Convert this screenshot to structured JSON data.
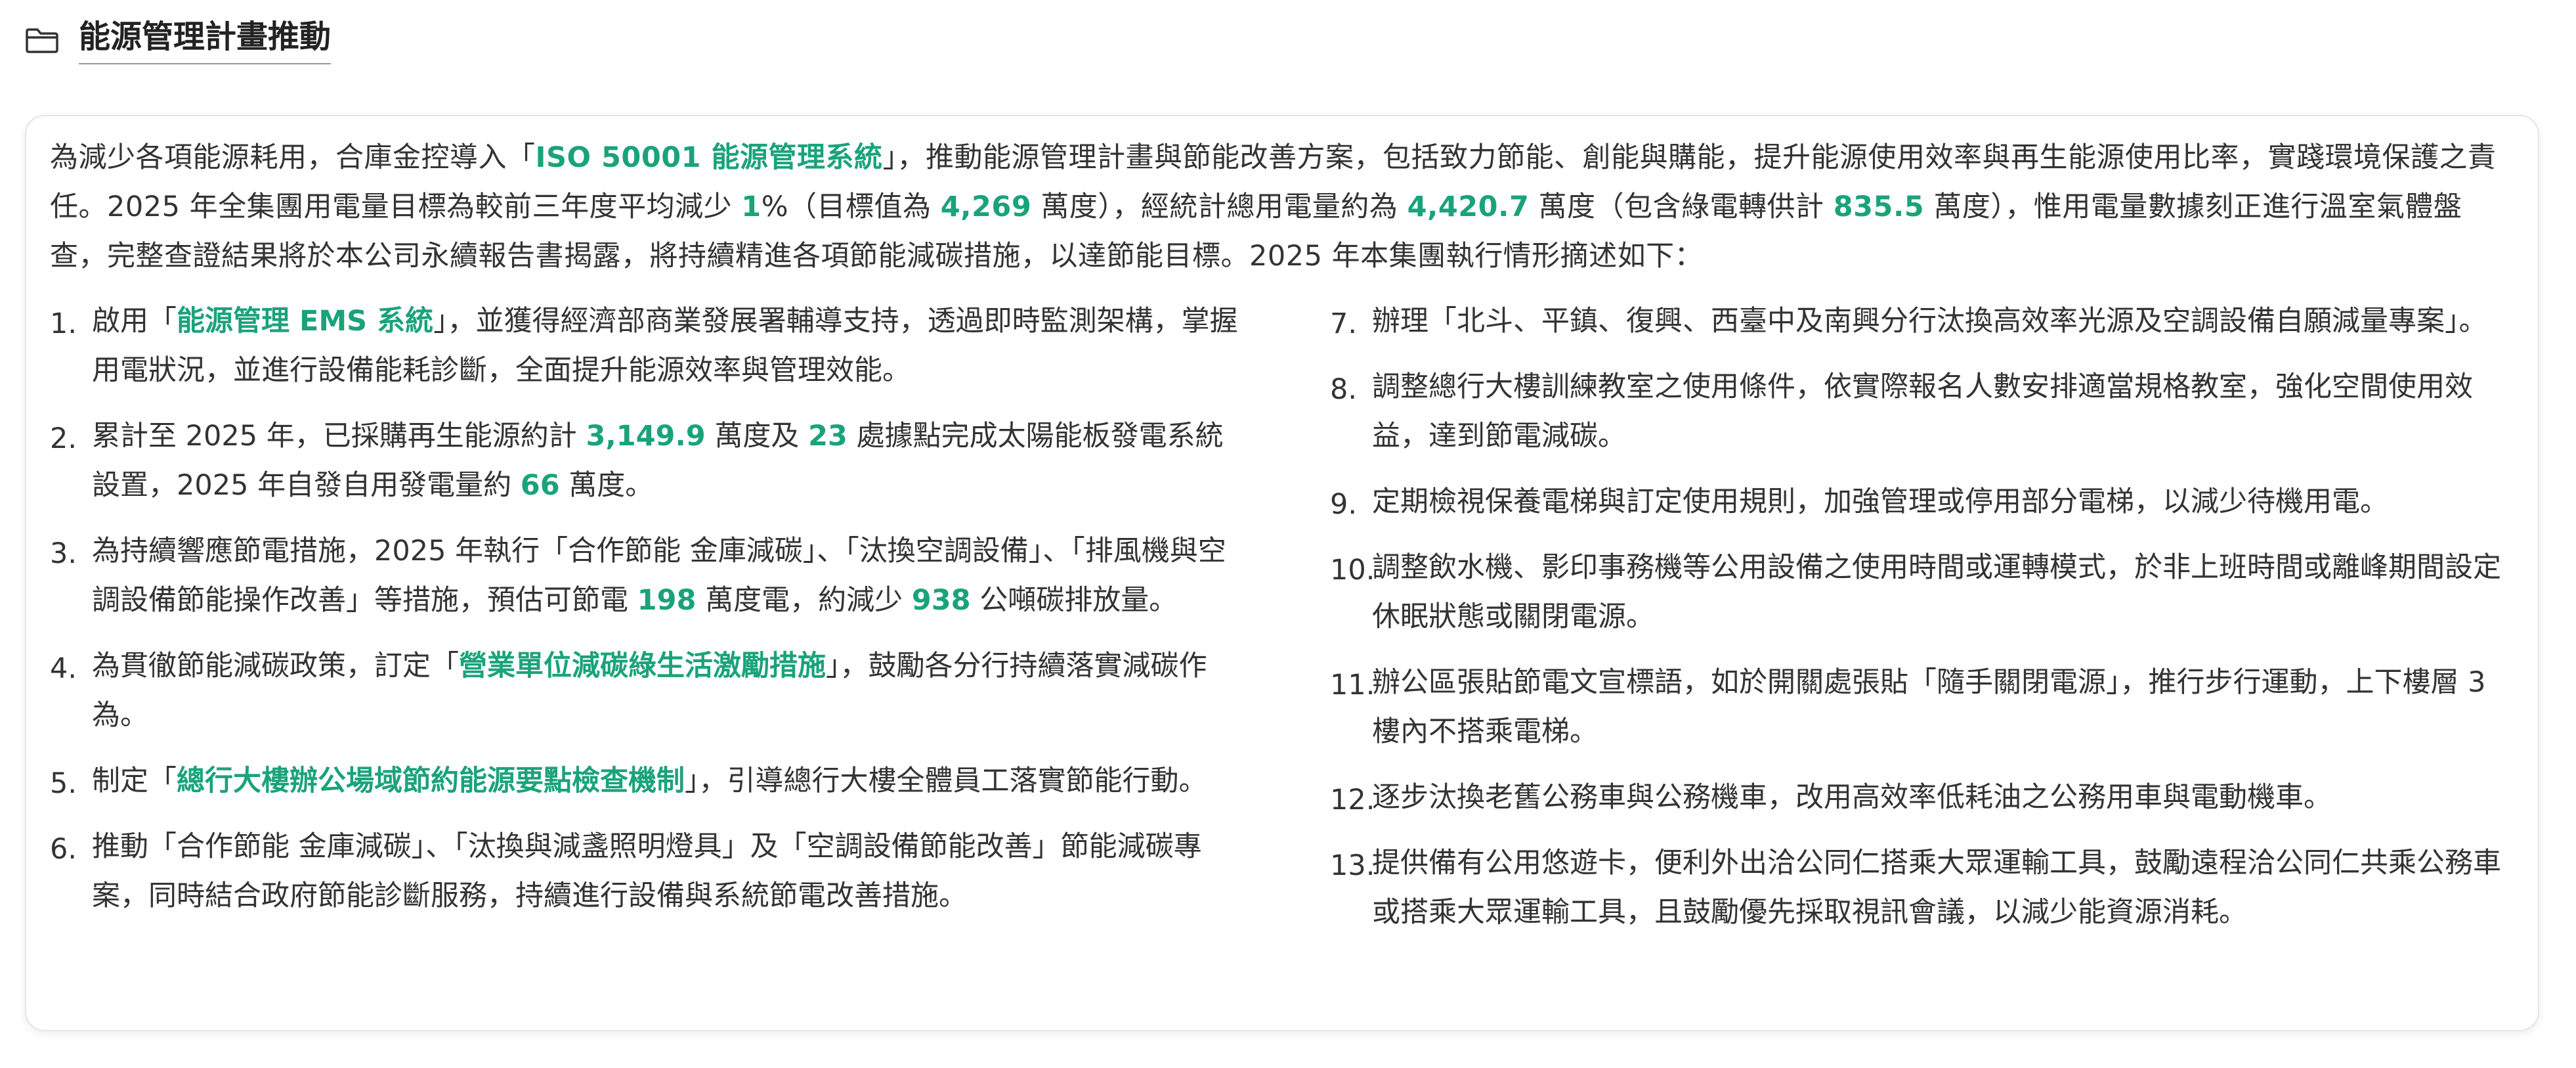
{
  "section": {
    "icon": "folder-icon",
    "title": "能源管理計畫推動"
  },
  "intro": {
    "t1": "為減少各項能源耗用，合庫金控導入「",
    "h1": "ISO 50001 能源管理系統",
    "t2": "」，推動能源管理計畫與節能改善方案，包括致力節能、創能與購能，提升能源使用效率與再生能源使用比率，實踐環境保護之責任。2025 年全集團用電量目標為較前三年度平均減少 ",
    "h2": "1",
    "t3": "%（目標值為 ",
    "h3": "4,269",
    "t4": " 萬度），經統計總用電量約為 ",
    "h4": "4,420.7",
    "t5": " 萬度（包含綠電轉供計 ",
    "h5": "835.5",
    "t6": " 萬度），惟用電量數據刻正進行溫室氣體盤查，完整查證結果將於本公司永續報告書揭露，將持續精進各項節能減碳措施，以達節能目標。2025 年本集團執行情形摘述如下："
  },
  "items": [
    {
      "num": "1.",
      "t1": "啟用「",
      "h1": "能源管理 EMS 系統",
      "t2": "」，並獲得經濟部商業發展署輔導支持，透過即時監測架構，掌握用電狀況，並進行設備能耗診斷，全面提升能源效率與管理效能。"
    },
    {
      "num": "2.",
      "t1": "累計至 2025 年，已採購再生能源約計 ",
      "h1": "3,149.9",
      "t2": " 萬度及 ",
      "h2": "23",
      "t3": " 處據點完成太陽能板發電系統設置，2025 年自發自用發電量約 ",
      "h3": "66",
      "t4": " 萬度。"
    },
    {
      "num": "3.",
      "t1": "為持續響應節電措施，2025 年執行「合作節能 金庫減碳」、「汰換空調設備」、「排風機與空調設備節能操作改善」等措施，預估可節電 ",
      "h1": "198",
      "t2": " 萬度電，約減少 ",
      "h2": "938",
      "t3": " 公噸碳排放量。"
    },
    {
      "num": "4.",
      "t1": "為貫徹節能減碳政策，訂定「",
      "h1": "營業單位減碳綠生活激勵措施",
      "t2": "」，鼓勵各分行持續落實減碳作為。"
    },
    {
      "num": "5.",
      "t1": "制定「",
      "h1": "總行大樓辦公場域節約能源要點檢查機制",
      "t2": "」，引導總行大樓全體員工落實節能行動。"
    },
    {
      "num": "6.",
      "t1": "推動「合作節能 金庫減碳」、「汰換與減盞照明燈具」及「空調設備節能改善」節能減碳專案，同時結合政府節能診斷服務，持續進行設備與系統節電改善措施。"
    },
    {
      "num": "7.",
      "t1": "辦理「北斗、平鎮、復興、西臺中及南興分行汰換高效率光源及空調設備自願減量專案」。"
    },
    {
      "num": "8.",
      "t1": "調整總行大樓訓練教室之使用條件，依實際報名人數安排適當規格教室，強化空間使用效益，達到節電減碳。"
    },
    {
      "num": "9.",
      "t1": "定期檢視保養電梯與訂定使用規則，加強管理或停用部分電梯，以減少待機用電。"
    },
    {
      "num": "10.",
      "t1": "調整飲水機、影印事務機等公用設備之使用時間或運轉模式，於非上班時間或離峰期間設定休眠狀態或關閉電源。"
    },
    {
      "num": "11.",
      "t1": "辦公區張貼節電文宣標語，如於開關處張貼「隨手關閉電源」，推行步行運動，上下樓層 3 樓內不搭乘電梯。"
    },
    {
      "num": "12.",
      "t1": "逐步汰換老舊公務車與公務機車，改用高效率低耗油之公務用車與電動機車。"
    },
    {
      "num": "13.",
      "t1": "提供備有公用悠遊卡，便利外出洽公同仁搭乘大眾運輸工具，鼓勵遠程洽公同仁共乘公務車或搭乘大眾運輸工具，且鼓勵優先採取視訊會議，以減少能資源消耗。"
    }
  ],
  "colors": {
    "accent": "#1aa37a",
    "text": "#333333",
    "title": "#222222",
    "border": "#e6e6e6"
  }
}
